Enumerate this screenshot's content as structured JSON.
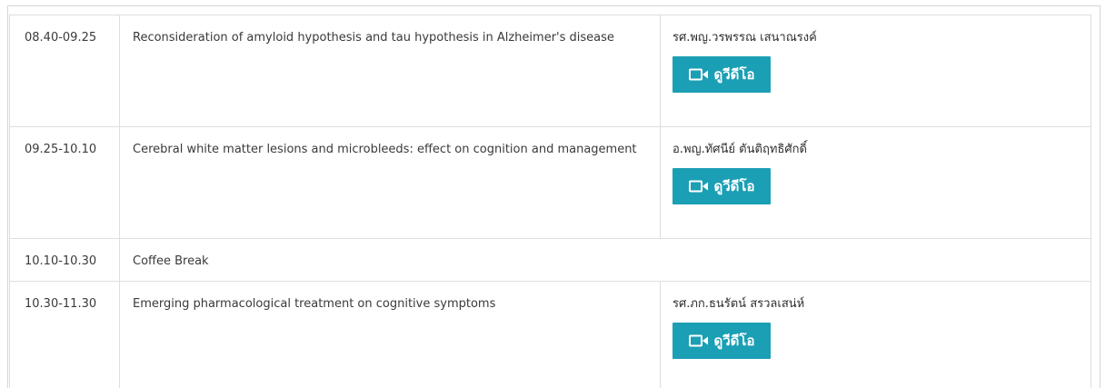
{
  "rows": [
    {
      "time": "08.40-09.25",
      "topic": "Reconsideration of amyloid hypothesis and tau hypothesis in Alzheimer's disease",
      "speaker": "รศ.พญ.วรพรรณ เสนาณรงค์",
      "button_label": "ดูวีดีโอ"
    },
    {
      "time": "09.25-10.10",
      "topic": "Cerebral white matter lesions and microbleeds: effect on cognition and management",
      "speaker": "อ.พญ.ทัศนีย์ ตันติฤทธิศักดิ์",
      "button_label": "ดูวีดีโอ"
    },
    {
      "time": "10.10-10.30",
      "topic": "Coffee Break",
      "speaker": ""
    },
    {
      "time": "10.30-11.30",
      "topic": "Emerging pharmacological treatment on cognitive symptoms",
      "speaker": "รศ.ภก.ธนรัตน์ สรวลเสน่ห์",
      "button_label": "ดูวีดีโอ"
    }
  ],
  "colors": {
    "button_bg": "#1b9fb4",
    "button_text": "#ffffff",
    "border": "#dedede"
  },
  "icons": {
    "video_button_icon": "video-camera-icon"
  }
}
